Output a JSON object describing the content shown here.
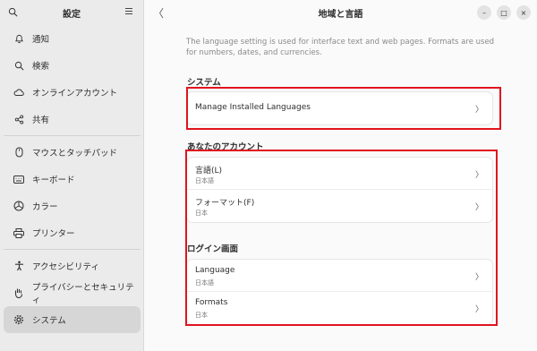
{
  "sidebar": {
    "title": "設定",
    "items": [
      {
        "label": "通知",
        "icon": "bell-icon"
      },
      {
        "label": "検索",
        "icon": "search-icon"
      },
      {
        "label": "オンラインアカウント",
        "icon": "cloud-icon"
      },
      {
        "label": "共有",
        "icon": "share-icon"
      },
      {
        "label": "マウスとタッチパッド",
        "icon": "mouse-icon"
      },
      {
        "label": "キーボード",
        "icon": "keyboard-icon"
      },
      {
        "label": "カラー",
        "icon": "color-icon"
      },
      {
        "label": "プリンター",
        "icon": "printer-icon"
      },
      {
        "label": "アクセシビリティ",
        "icon": "accessibility-icon"
      },
      {
        "label": "プライバシーとセキュリティ",
        "icon": "hand-icon"
      },
      {
        "label": "システム",
        "icon": "gear-icon"
      }
    ]
  },
  "header": {
    "title": "地域と言語",
    "back_glyph": "〈",
    "minimize": "–",
    "maximize": "□",
    "close": "×"
  },
  "description": "The language setting is used for interface text and web pages. Formats are used for numbers, dates, and currencies.",
  "system_section": {
    "title": "システム",
    "row": {
      "label": "Manage Installed Languages"
    }
  },
  "account_section": {
    "title": "あなたのアカウント",
    "rows": [
      {
        "label": "言語(L)",
        "value": "日本語"
      },
      {
        "label": "フォーマット(F)",
        "value": "日本"
      }
    ]
  },
  "login_section": {
    "title": "ログイン画面",
    "rows": [
      {
        "label": "Language",
        "value": "日本語"
      },
      {
        "label": "Formats",
        "value": "日本"
      }
    ]
  },
  "chevron_glyph": "〉",
  "colors": {
    "highlight": "#e0141e",
    "sidebar_bg": "#ebebeb",
    "main_bg": "#fafafa"
  }
}
